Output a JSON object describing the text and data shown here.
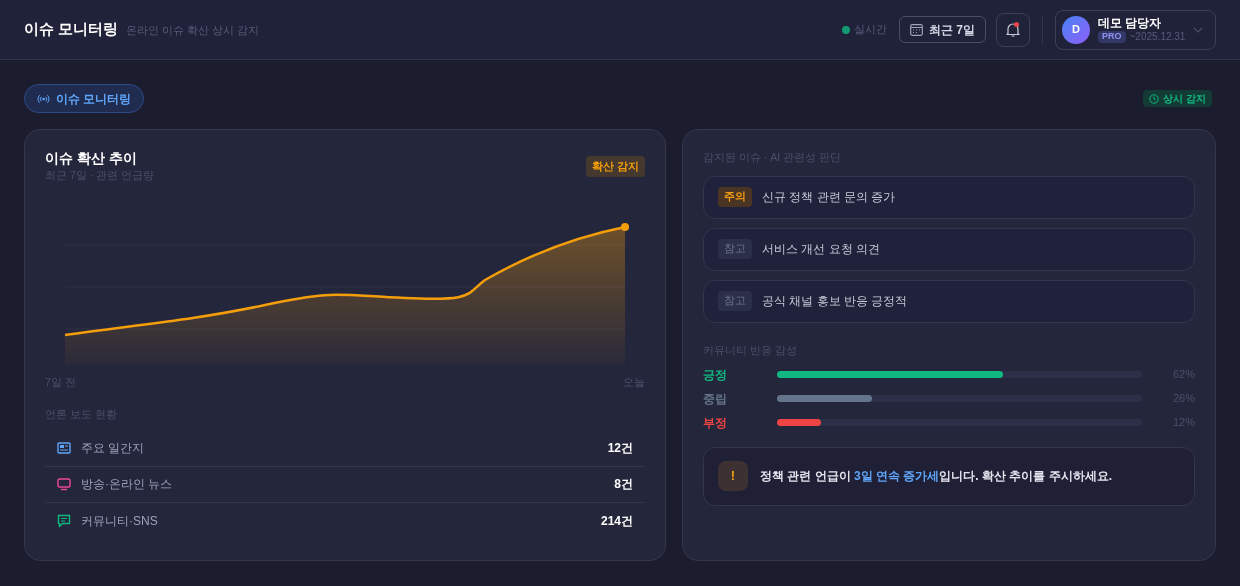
{
  "header": {
    "title": "이슈 모니터링",
    "subtitle": "온라인 이슈 확산 상시 감지",
    "live": "실시간",
    "range": "최근 7일",
    "notification": true,
    "user": {
      "initial": "D",
      "name": "데모 담당자",
      "plan": "PRO",
      "expiry": "~2025.12.31"
    }
  },
  "page_tab": "이슈 모니터링",
  "status_badge": "상시 감지",
  "trend": {
    "title": "이슈 확산 추이",
    "subtitle": "최근 7일 · 관련 언급량",
    "badge": "확산 감지",
    "x_start": "7일 전",
    "x_end": "오늘"
  },
  "media": {
    "title": "언론 보도 현황",
    "rows": [
      {
        "kind": "newspaper",
        "label": "주요 일간지",
        "count": "12건"
      },
      {
        "kind": "tv",
        "label": "방송·온라인 뉴스",
        "count": "8건"
      },
      {
        "kind": "chat",
        "label": "커뮤니티·SNS",
        "count": "214건"
      }
    ]
  },
  "issues": {
    "title": "감지된 이슈 · AI 관련성 판단",
    "items": [
      {
        "kind": "caution",
        "tag": "주의",
        "text": "신규 정책 관련 문의 증가"
      },
      {
        "kind": "note",
        "tag": "참고",
        "text": "서비스 개선 요청 의견"
      },
      {
        "kind": "note",
        "tag": "참고",
        "text": "공식 채널 홍보 반응 긍정적"
      }
    ]
  },
  "sentiment": {
    "title": "커뮤니티 반응 감성",
    "rows": [
      {
        "label": "긍정",
        "color": "#10b981",
        "level": 0.62,
        "reading": "62%"
      },
      {
        "label": "중립",
        "color": "#64748b",
        "level": 0.26,
        "reading": "26%"
      },
      {
        "label": "부정",
        "color": "#ef4444",
        "level": 0.12,
        "reading": "12%"
      }
    ]
  },
  "alert": {
    "icon": "!",
    "text": "정책 관련 언급이 **3일 연속 증가세**입니다. 확산 추이를 주시하세요."
  }
}
